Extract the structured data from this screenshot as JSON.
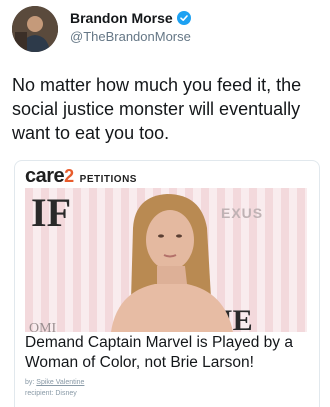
{
  "tweet": {
    "author_name": "Brandon Morse",
    "handle": "@TheBrandonMorse",
    "text": "No matter how much you feed it, the social justice monster will eventually want to eat you too."
  },
  "card": {
    "logo_text": "care",
    "logo_number": "2",
    "logo_suffix": "PETITIONS",
    "title": "Demand Captain Marvel is Played by a Woman of Color, not Brie Larson!",
    "by_label": "by:",
    "by_name": "Spike Valentine",
    "recipient_label": "recipient:",
    "recipient_name": "Disney"
  },
  "colors": {
    "verified_badge": "#1da1f2",
    "care2_accent": "#e85c2c"
  },
  "icons": {
    "verified": "verified-check-icon"
  }
}
